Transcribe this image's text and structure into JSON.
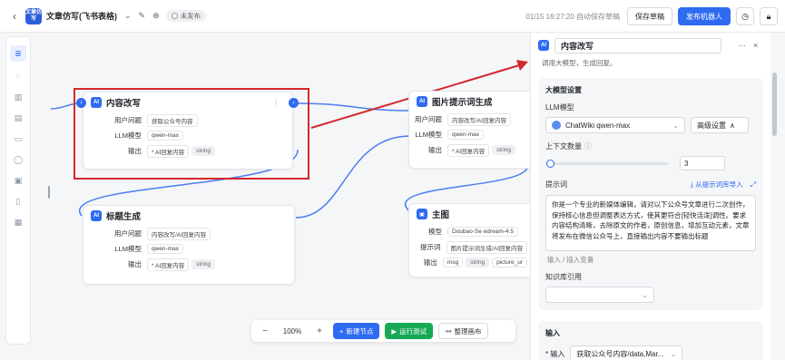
{
  "app": {
    "logo_text": "文章仿写",
    "title": "文章仿写(飞书表格)",
    "status": "未发布"
  },
  "topbar": {
    "autosave": "01/15 16:27:20 自动保存草稿",
    "save_label": "保存草稿",
    "publish_label": "发布机器人"
  },
  "nodes": {
    "rewrite": {
      "icon": "AI",
      "title": "内容改写",
      "rows": [
        {
          "label": "用户问题",
          "chips": [
            "获取公众号内容"
          ]
        },
        {
          "label": "LLM模型",
          "chips": [
            "qwen-max"
          ]
        },
        {
          "label": "输出",
          "chips": [
            "* AI回复内容",
            "string"
          ]
        }
      ]
    },
    "title_gen": {
      "icon": "AI",
      "title": "标题生成",
      "rows": [
        {
          "label": "用户问题",
          "chips": [
            "内容改写/AI回复内容"
          ]
        },
        {
          "label": "LLM模型",
          "chips": [
            "qwen-max"
          ]
        },
        {
          "label": "输出",
          "chips": [
            "* AI回复内容",
            "string"
          ]
        }
      ]
    },
    "image_prompt": {
      "icon": "AI",
      "title": "图片提示词生成",
      "rows": [
        {
          "label": "用户问题",
          "chips": [
            "内容改写/AI回复内容"
          ]
        },
        {
          "label": "LLM模型",
          "chips": [
            "qwen-max"
          ]
        },
        {
          "label": "输出",
          "chips": [
            "* AI回复内容",
            "string"
          ]
        }
      ]
    },
    "main_image": {
      "icon": "▣",
      "title": "主图",
      "rows": [
        {
          "label": "模型",
          "chips": [
            "Doubao-Se edream-4.5"
          ]
        },
        {
          "label": "提示词",
          "chips": [
            "图片提示词生成/AI回复内容"
          ]
        },
        {
          "label": "输出",
          "chips": [
            "msg",
            "string",
            "picture_ur"
          ]
        }
      ]
    }
  },
  "zoombar": {
    "minus": "−",
    "zoom": "100%",
    "plus": "+",
    "new_node": "新建节点",
    "run_test": "运行测试",
    "tidy": "整理画布"
  },
  "panel": {
    "title": "内容改写",
    "subtitle": "调用大模型，生成回复。",
    "llm_section": "大模型设置",
    "llm_label": "LLM模型",
    "model_value": "ChatWiki qwen-max",
    "advanced": "高级设置",
    "context_label": "上下文数量",
    "context_value": "3",
    "prompt_label": "提示词",
    "prompt_import": "从提示词库导入",
    "prompt_text": "你是一个专业的新媒体编辑，请对以下公众号文章进行二次创作，保持核心信息但调整表达方式，使其更符合[轻快活泼]调性。要求内容结构清晰，去除原文的作者，原创信息，增加互动元素，文章将发布在微信公众号上，直接输出内容不要输出标题",
    "insert_var": "输入 / 插入变量",
    "kb_label": "知识库引用",
    "input_section": "输入",
    "input_label": "* 输入",
    "input_value": "获取公众号内容/data,Mar..."
  }
}
